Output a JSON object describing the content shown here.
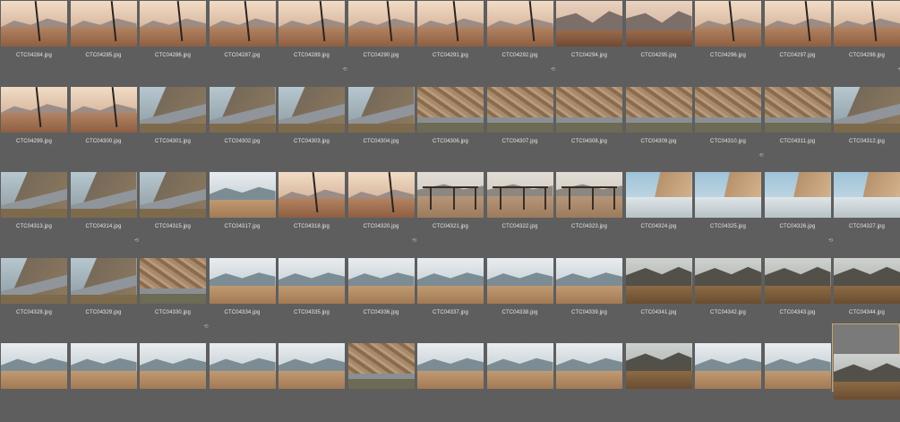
{
  "colors": {
    "background": "#5e5e5e",
    "label_text": "#e6e6e6",
    "selection_border": "#c9a26b",
    "selection_fill": "#7a7a7a"
  },
  "thumbnails": [
    {
      "file": "CTC04284.jpg",
      "scene": "tree",
      "sync": false
    },
    {
      "file": "CTC04285.jpg",
      "scene": "tree",
      "sync": false
    },
    {
      "file": "CTC04286.jpg",
      "scene": "tree",
      "sync": false
    },
    {
      "file": "CTC04287.jpg",
      "scene": "tree",
      "sync": false
    },
    {
      "file": "CTC04289.jpg",
      "scene": "tree",
      "sync": true
    },
    {
      "file": "CTC04290.jpg",
      "scene": "tree",
      "sync": false
    },
    {
      "file": "CTC04291.jpg",
      "scene": "tree",
      "sync": false
    },
    {
      "file": "CTC04292.jpg",
      "scene": "tree",
      "sync": true
    },
    {
      "file": "CTC04294.jpg",
      "scene": "canyon",
      "sync": false
    },
    {
      "file": "CTC04295.jpg",
      "scene": "canyon",
      "sync": false
    },
    {
      "file": "CTC04296.jpg",
      "scene": "tree",
      "sync": false
    },
    {
      "file": "CTC04297.jpg",
      "scene": "tree",
      "sync": false
    },
    {
      "file": "CTC04298.jpg",
      "scene": "tree",
      "sync": true
    },
    {
      "file": "CTC04299.jpg",
      "scene": "tree",
      "sync": false
    },
    {
      "file": "CTC04300.jpg",
      "scene": "tree",
      "sync": false
    },
    {
      "file": "CTC04301.jpg",
      "scene": "roadcurve",
      "sync": false
    },
    {
      "file": "CTC04302.jpg",
      "scene": "roadcurve",
      "sync": false
    },
    {
      "file": "CTC04303.jpg",
      "scene": "roadcurve",
      "sync": false
    },
    {
      "file": "CTC04304.jpg",
      "scene": "roadcurve",
      "sync": false
    },
    {
      "file": "CTC04306.jpg",
      "scene": "rockwall",
      "sync": false
    },
    {
      "file": "CTC04307.jpg",
      "scene": "rockwall",
      "sync": false
    },
    {
      "file": "CTC04308.jpg",
      "scene": "rockwall",
      "sync": false
    },
    {
      "file": "CTC04309.jpg",
      "scene": "rockwall",
      "sync": false
    },
    {
      "file": "CTC04310.jpg",
      "scene": "rockwall",
      "sync": true
    },
    {
      "file": "CTC04311.jpg",
      "scene": "rockwall",
      "sync": false
    },
    {
      "file": "CTC04312.jpg",
      "scene": "roadcurve",
      "sync": false
    },
    {
      "file": "CTC04313.jpg",
      "scene": "roadcurve",
      "sync": false
    },
    {
      "file": "CTC04314.jpg",
      "scene": "roadcurve",
      "sync": true
    },
    {
      "file": "CTC04315.jpg",
      "scene": "roadcurve",
      "sync": false
    },
    {
      "file": "CTC04317.jpg",
      "scene": "hazy",
      "sync": false
    },
    {
      "file": "CTC04318.jpg",
      "scene": "tree",
      "sync": false
    },
    {
      "file": "CTC04320.jpg",
      "scene": "tree",
      "sync": true
    },
    {
      "file": "CTC04321.jpg",
      "scene": "fence",
      "sync": false
    },
    {
      "file": "CTC04322.jpg",
      "scene": "fence",
      "sync": false
    },
    {
      "file": "CTC04323.jpg",
      "scene": "fence",
      "sync": false
    },
    {
      "file": "CTC04324.jpg",
      "scene": "paleroad",
      "sync": false
    },
    {
      "file": "CTC04325.jpg",
      "scene": "paleroad",
      "sync": false
    },
    {
      "file": "CTC04326.jpg",
      "scene": "paleroad",
      "sync": true
    },
    {
      "file": "CTC04327.jpg",
      "scene": "paleroad",
      "sync": false
    },
    {
      "file": "CTC04328.jpg",
      "scene": "roadcurve",
      "sync": false
    },
    {
      "file": "CTC04329.jpg",
      "scene": "roadcurve",
      "sync": false
    },
    {
      "file": "CTC04330.jpg",
      "scene": "rockwall",
      "sync": true
    },
    {
      "file": "CTC04334.jpg",
      "scene": "hazy",
      "sync": false
    },
    {
      "file": "CTC04335.jpg",
      "scene": "hazy",
      "sync": false
    },
    {
      "file": "CTC04336.jpg",
      "scene": "hazy",
      "sync": false
    },
    {
      "file": "CTC04337.jpg",
      "scene": "hazy",
      "sync": false
    },
    {
      "file": "CTC04338.jpg",
      "scene": "hazy",
      "sync": false
    },
    {
      "file": "CTC04339.jpg",
      "scene": "hazy",
      "sync": false
    },
    {
      "file": "CTC04341.jpg",
      "scene": "dark",
      "sync": false
    },
    {
      "file": "CTC04342.jpg",
      "scene": "dark",
      "sync": false
    },
    {
      "file": "CTC04343.jpg",
      "scene": "dark",
      "sync": false
    },
    {
      "file": "CTC04344.jpg",
      "scene": "dark",
      "sync": true
    },
    {
      "file": "",
      "scene": "hazy",
      "sync": false
    },
    {
      "file": "",
      "scene": "hazy",
      "sync": false
    },
    {
      "file": "",
      "scene": "hazy",
      "sync": false
    },
    {
      "file": "",
      "scene": "hazy",
      "sync": false
    },
    {
      "file": "",
      "scene": "hazy",
      "sync": false
    },
    {
      "file": "",
      "scene": "rockwall",
      "sync": false
    },
    {
      "file": "",
      "scene": "hazy",
      "sync": false
    },
    {
      "file": "",
      "scene": "hazy",
      "sync": false
    },
    {
      "file": "",
      "scene": "hazy",
      "sync": false
    },
    {
      "file": "",
      "scene": "dark",
      "sync": false
    },
    {
      "file": "",
      "scene": "hazy",
      "sync": false
    },
    {
      "file": "",
      "scene": "hazy",
      "sync": false
    },
    {
      "file": "",
      "scene": "dark",
      "sync": false
    }
  ]
}
